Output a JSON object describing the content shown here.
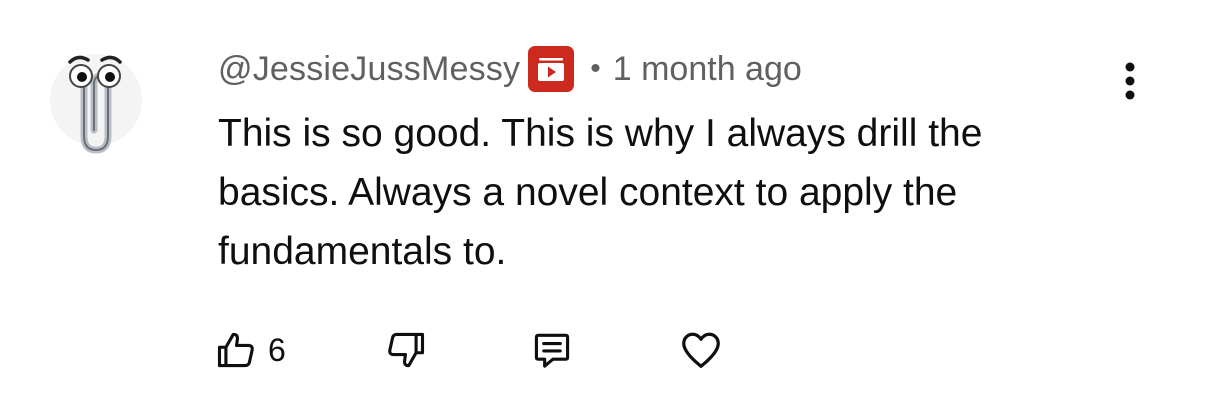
{
  "comment": {
    "author": "@JessieJussMessy",
    "separator": "•",
    "time": "1 month ago",
    "text": "This is so good. This is why I always drill the\nbasics. Always a novel context to apply the\nfundamentals to.",
    "like_count": "6"
  },
  "icons": {
    "avatar": "clippy-paperclip-avatar",
    "badge": "member-badge-play-icon",
    "menu": "more-vertical-icon",
    "like": "thumbs-up-icon",
    "dislike": "thumbs-down-icon",
    "reply": "reply-comment-icon",
    "heart": "heart-icon"
  },
  "colors": {
    "badge": "#cc2a1f",
    "text": "#0f0f0f",
    "secondary_text": "#606060"
  }
}
